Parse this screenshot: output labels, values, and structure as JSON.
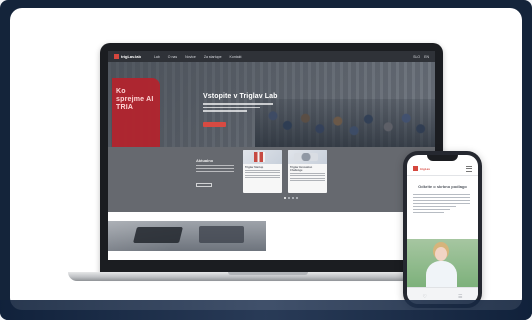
{
  "laptop": {
    "brand": "trigLav.lab",
    "hero": {
      "left_text": "Ko sprejme AI TRIA",
      "title": "Vstopite v Triglav Lab"
    },
    "nav": {
      "items": [
        "Lab",
        "O nas",
        "Novice",
        "Za startupe",
        "Kontakt"
      ],
      "right_items": [
        "SLO",
        "EN"
      ]
    },
    "news": {
      "title": "Aktualno",
      "cards": [
        {
          "title": "Triglav Startup"
        },
        {
          "title": "Triglav Innovation Challenge"
        }
      ]
    }
  },
  "phone": {
    "brand": "trigLav",
    "heading": "Odkrite o skrbno podlago",
    "footer_icons": [
      "♡",
      "☰"
    ]
  },
  "colors": {
    "accent": "#d84a42",
    "frame": "#14243a"
  }
}
